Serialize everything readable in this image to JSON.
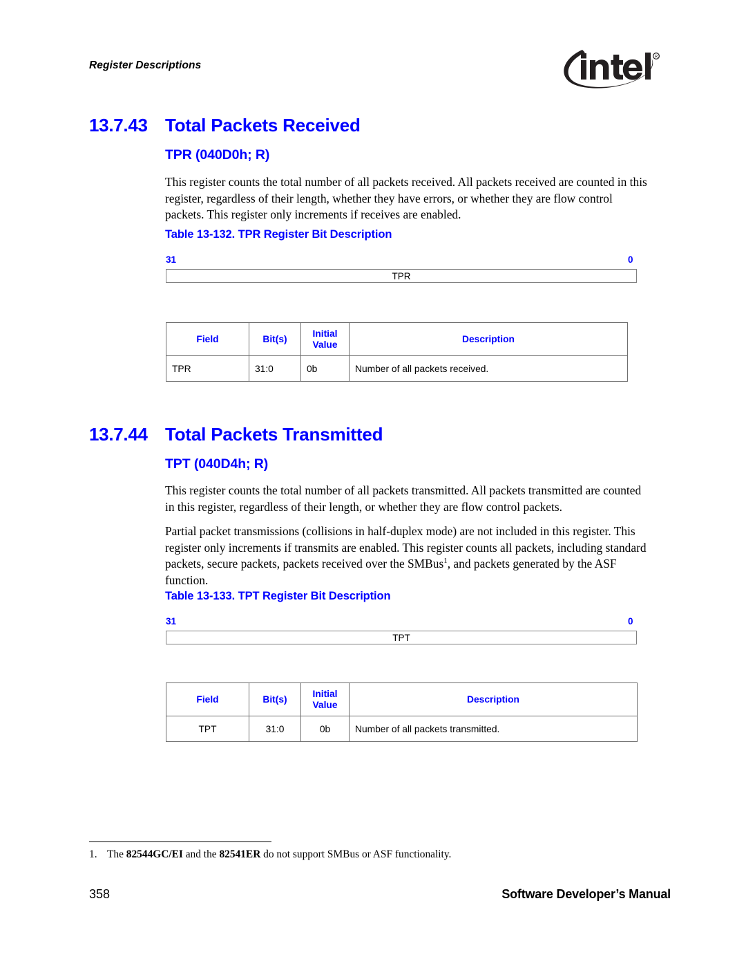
{
  "header": {
    "running_title": "Register Descriptions",
    "logo_text": "intel",
    "logo_trademark": "®"
  },
  "sections": [
    {
      "number": "13.7.43",
      "title": "Total Packets Received",
      "subtitle": "TPR (040D0h; R)",
      "paragraphs": [
        "This register counts the total number of all packets received. All packets received are counted in this register, regardless of their length, whether they have errors, or whether they are flow control packets. This register only increments if receives are enabled."
      ],
      "table_caption": "Table 13-132. TPR Register Bit Description",
      "bit_diagram": {
        "msb_label": "31",
        "lsb_label": "0",
        "field_name": "TPR"
      },
      "table": {
        "columns": [
          "Field",
          "Bit(s)",
          "Initial Value",
          "Description"
        ],
        "rows": [
          {
            "field": "TPR",
            "bits": "31:0",
            "initial_value": "0b",
            "description": "Number of all packets received."
          }
        ]
      }
    },
    {
      "number": "13.7.44",
      "title": "Total Packets Transmitted",
      "subtitle": "TPT (040D4h; R)",
      "paragraphs": [
        "This register counts the total number of all packets transmitted. All packets transmitted are counted in this register, regardless of their length, or whether they are flow control packets.",
        "Partial packet transmissions (collisions in half-duplex mode) are not included in this register. This register only increments if transmits are enabled. This register counts all packets, including standard packets, secure packets, packets received over the SMBus"
      ],
      "paragraph_2_footnote_marker": "1",
      "paragraph_2_tail": ", and packets generated by the ASF function.",
      "table_caption": "Table 13-133. TPT Register Bit Description",
      "bit_diagram": {
        "msb_label": "31",
        "lsb_label": "0",
        "field_name": "TPT"
      },
      "table": {
        "columns": [
          "Field",
          "Bit(s)",
          "Initial Value",
          "Description"
        ],
        "rows": [
          {
            "field": "TPT",
            "bits": "31:0",
            "initial_value": "0b",
            "description": "Number of all packets transmitted."
          }
        ]
      }
    }
  ],
  "footnote": {
    "number": "1.",
    "text_before": "The ",
    "bold_1": "82544GC/EI",
    "text_middle": " and the ",
    "bold_2": "82541ER",
    "text_after": " do not support SMBus or ASF functionality."
  },
  "footer": {
    "page_number": "358",
    "document_title": "Software Developer’s Manual"
  },
  "colors": {
    "heading_blue": "#0000FF",
    "table_border": "#6E6E6E",
    "box_border": "#808080",
    "text_black": "#000000"
  }
}
